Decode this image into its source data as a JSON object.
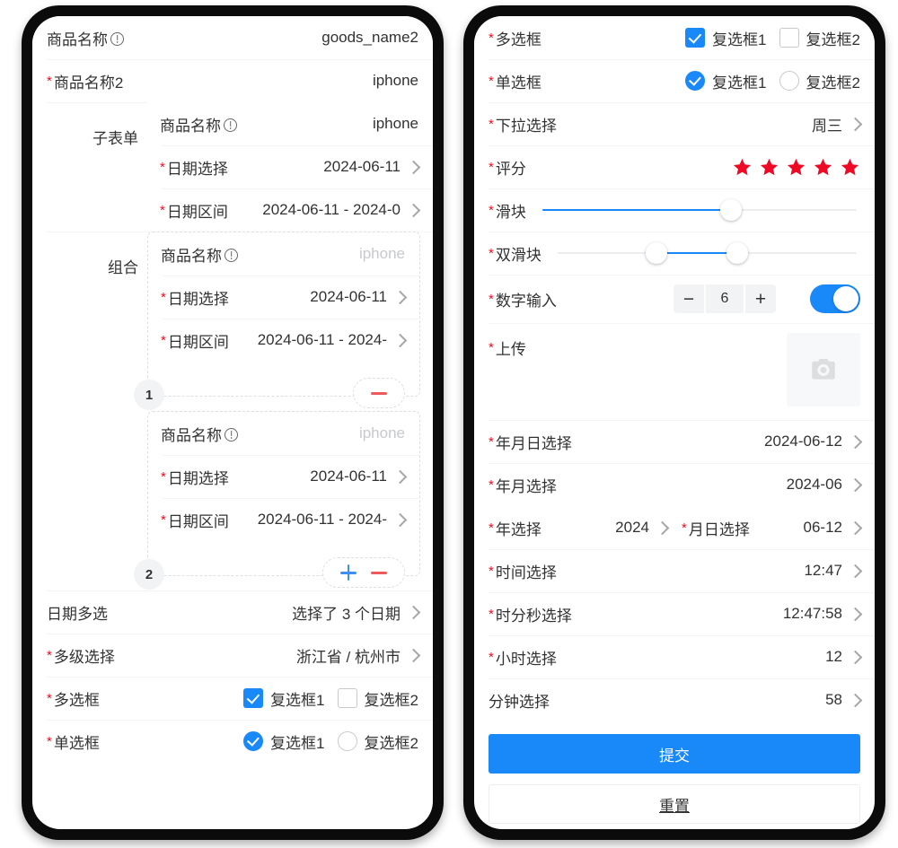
{
  "colors": {
    "primary": "#1989fa",
    "danger": "#ee0a24",
    "border": "#ebedf0",
    "placeholder": "#c8c9cc"
  },
  "left_panel": {
    "rows": [
      {
        "label": "商品名称",
        "required": false,
        "info": true,
        "value": "goods_name2",
        "chevron": false
      },
      {
        "label": "商品名称2",
        "required": true,
        "info": false,
        "value": "iphone",
        "chevron": false
      }
    ],
    "subform": {
      "title": "子表单",
      "rows": [
        {
          "label": "商品名称",
          "required": false,
          "info": true,
          "value": "iphone",
          "chevron": false
        },
        {
          "label": "日期选择",
          "required": true,
          "info": false,
          "value": "2024-06-11",
          "chevron": true
        },
        {
          "label": "日期区间",
          "required": true,
          "info": false,
          "value": "2024-06-11 - 2024-0",
          "chevron": true
        }
      ]
    },
    "combination": {
      "title": "组合",
      "groups": [
        {
          "badge": "1",
          "has_add": false,
          "has_remove": true,
          "rows": [
            {
              "label": "商品名称",
              "required": false,
              "info": true,
              "value": "iphone",
              "placeholder": true,
              "chevron": false
            },
            {
              "label": "日期选择",
              "required": true,
              "info": false,
              "value": "2024-06-11",
              "placeholder": false,
              "chevron": true
            },
            {
              "label": "日期区间",
              "required": true,
              "info": false,
              "value": "2024-06-11 - 2024-",
              "placeholder": false,
              "chevron": true
            }
          ]
        },
        {
          "badge": "2",
          "has_add": true,
          "has_remove": true,
          "rows": [
            {
              "label": "商品名称",
              "required": false,
              "info": true,
              "value": "iphone",
              "placeholder": true,
              "chevron": false
            },
            {
              "label": "日期选择",
              "required": true,
              "info": false,
              "value": "2024-06-11",
              "placeholder": false,
              "chevron": true
            },
            {
              "label": "日期区间",
              "required": true,
              "info": false,
              "value": "2024-06-11 - 2024-",
              "placeholder": false,
              "chevron": true
            }
          ]
        }
      ]
    },
    "tail_rows": [
      {
        "label": "日期多选",
        "required": false,
        "value": "选择了 3 个日期",
        "chevron": true
      },
      {
        "label": "多级选择",
        "required": true,
        "value": "浙江省 / 杭州市",
        "chevron": true
      }
    ],
    "checkbox_row": {
      "label": "多选框",
      "required": true,
      "options": [
        {
          "text": "复选框1",
          "checked": true
        },
        {
          "text": "复选框2",
          "checked": false
        }
      ]
    },
    "radio_row": {
      "label": "单选框",
      "required": true,
      "options": [
        {
          "text": "复选框1",
          "checked": true
        },
        {
          "text": "复选框2",
          "checked": false
        }
      ]
    }
  },
  "right_panel": {
    "checkbox_row": {
      "label": "多选框",
      "required": true,
      "options": [
        {
          "text": "复选框1",
          "checked": true
        },
        {
          "text": "复选框2",
          "checked": false
        }
      ]
    },
    "radio_row": {
      "label": "单选框",
      "required": true,
      "options": [
        {
          "text": "复选框1",
          "checked": true
        },
        {
          "text": "复选框2",
          "checked": false
        }
      ]
    },
    "select_row": {
      "label": "下拉选择",
      "required": true,
      "value": "周三",
      "chevron": true
    },
    "rate_row": {
      "label": "评分",
      "required": true,
      "stars_total": 5,
      "stars_filled": 5
    },
    "slider_row": {
      "label": "滑块",
      "required": true,
      "value": 60
    },
    "range_row": {
      "label": "双滑块",
      "required": true,
      "min_value": 33,
      "max_value": 60
    },
    "stepper_row": {
      "label": "数字输入",
      "required": true,
      "minus_label": "−",
      "value": "6",
      "plus_label": "+",
      "switch_on": true
    },
    "upload_row": {
      "label": "上传",
      "required": true,
      "icon": "camera-icon"
    },
    "picker_rows": [
      {
        "label": "年月日选择",
        "required": true,
        "value": "2024-06-12",
        "chevron": true
      },
      {
        "label": "年月选择",
        "required": true,
        "value": "2024-06",
        "chevron": true
      }
    ],
    "split_row": {
      "left": {
        "label": "年选择",
        "required": true,
        "value": "2024",
        "chevron": true
      },
      "right": {
        "label": "月日选择",
        "required": true,
        "value": "06-12",
        "chevron": true
      }
    },
    "time_rows": [
      {
        "label": "时间选择",
        "required": true,
        "value": "12:47",
        "chevron": true
      },
      {
        "label": "时分秒选择",
        "required": true,
        "value": "12:47:58",
        "chevron": true
      },
      {
        "label": "小时选择",
        "required": true,
        "value": "12",
        "chevron": true
      },
      {
        "label": "分钟选择",
        "required": false,
        "value": "58",
        "chevron": true
      }
    ],
    "buttons": {
      "submit_label": "提交",
      "reset_label": "重置"
    }
  }
}
